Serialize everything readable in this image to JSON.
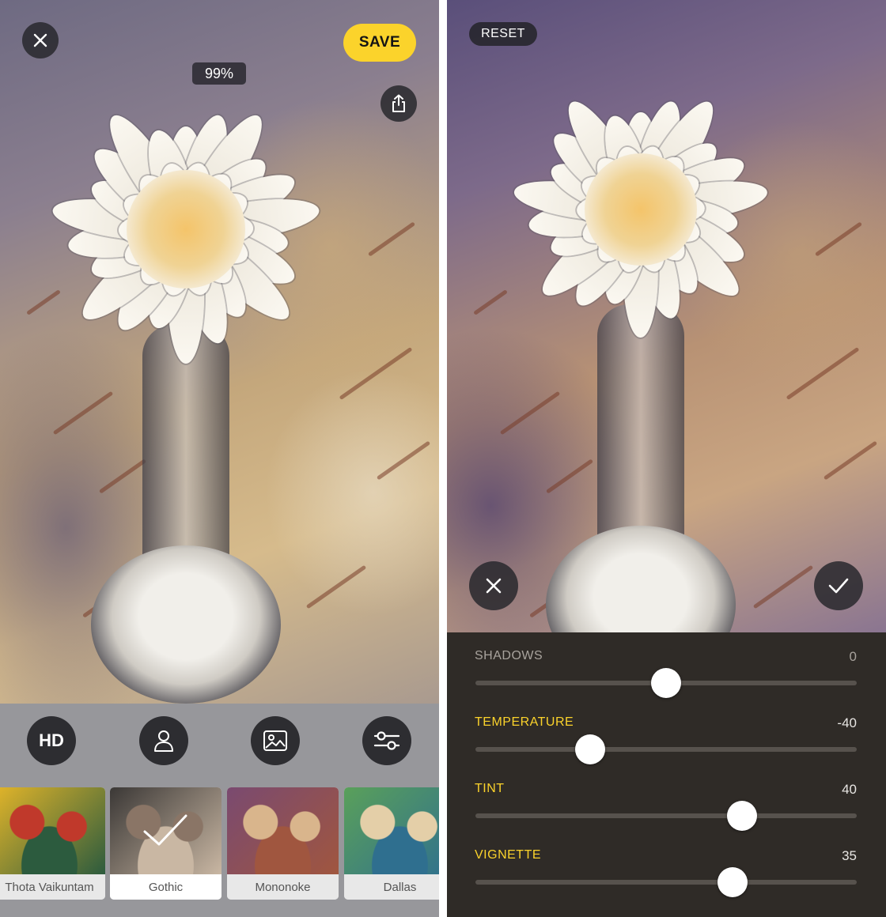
{
  "left_screen": {
    "save_label": "SAVE",
    "progress_percent": "99%",
    "tools": [
      {
        "label": "HD",
        "icon": "hd-icon"
      },
      {
        "icon": "portrait-icon"
      },
      {
        "icon": "image-icon"
      },
      {
        "icon": "sliders-icon"
      }
    ],
    "styles": [
      {
        "label": "Thota Vaikuntam",
        "selected": false,
        "colors": [
          "#e3b529",
          "#c0392b",
          "#2c5b3e"
        ]
      },
      {
        "label": "Gothic",
        "selected": true,
        "colors": [
          "#3b3836",
          "#8a7566",
          "#c9b7a3"
        ]
      },
      {
        "label": "Mononoke",
        "selected": false,
        "colors": [
          "#7a4a70",
          "#d9b58c",
          "#a0563f"
        ]
      },
      {
        "label": "Dallas",
        "selected": false,
        "colors": [
          "#5aa05a",
          "#e4cfa8",
          "#2f6f8f"
        ]
      }
    ]
  },
  "right_screen": {
    "reset_label": "RESET",
    "adjustments": [
      {
        "label": "SHADOWS",
        "value": "0",
        "level": 0.5,
        "active": false
      },
      {
        "label": "TEMPERATURE",
        "value": "-40",
        "level": 0.3,
        "active": true
      },
      {
        "label": "TINT",
        "value": "40",
        "level": 0.7,
        "active": true
      },
      {
        "label": "VIGNETTE",
        "value": "35",
        "level": 0.675,
        "active": true
      }
    ]
  },
  "colors": {
    "accent_yellow": "#fbd32b",
    "inactive_label": "#a8a39d",
    "value_text": "#e8e6e3",
    "panel_bg": "#2f2b27"
  }
}
